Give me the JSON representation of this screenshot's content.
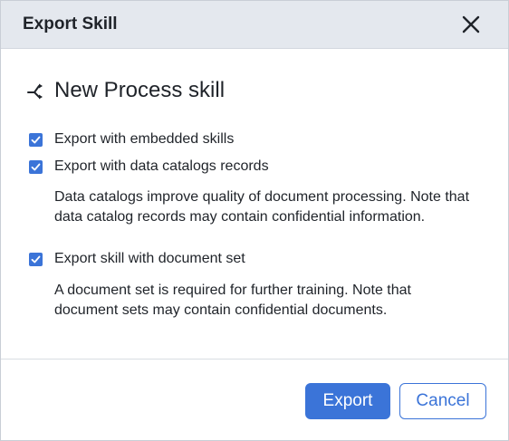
{
  "dialog": {
    "title": "Export Skill",
    "close_icon": "close-icon"
  },
  "skill": {
    "icon": "process-skill-icon",
    "name": "New Process skill"
  },
  "options": [
    {
      "label": "Export with embedded skills",
      "checked": true
    },
    {
      "label": "Export with data catalogs records",
      "checked": true,
      "note_line1": "Data catalogs improve quality of document processing. Note that",
      "note_line2": "data catalog records may contain confidential information."
    },
    {
      "label": "Export skill with document set",
      "checked": true,
      "note_line1": "A document set is required for further training. Note that",
      "note_line2": "document sets may contain confidential documents."
    }
  ],
  "buttons": {
    "export_label": "Export",
    "cancel_label": "Cancel"
  },
  "colors": {
    "accent": "#3b74d8",
    "header_bg": "#e4e8ee"
  }
}
